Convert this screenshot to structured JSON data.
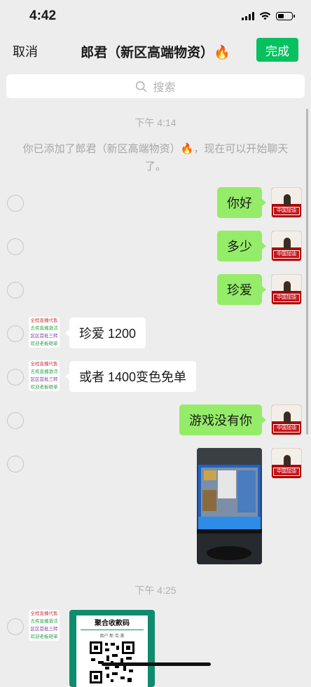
{
  "status": {
    "time": "4:42",
    "battery_level": 0.45
  },
  "nav": {
    "cancel_label": "取消",
    "title": "郎君（新区高端物资）🔥",
    "done_label": "完成"
  },
  "search": {
    "placeholder": "搜索"
  },
  "timestamps": [
    "下午 4:14",
    "下午 4:25"
  ],
  "system_message": "你已添加了郎君（新区高端物资）🔥，现在可以开始聊天了。",
  "contact_avatar_lines": [
    "全程直播代售",
    "去疾直播激活",
    "区区首批三转",
    "欢迎老板砸单"
  ],
  "self_avatar_text": "中国加油",
  "messages": [
    {
      "from": "self",
      "text": "你好"
    },
    {
      "from": "self",
      "text": "多少"
    },
    {
      "from": "self",
      "text": "珍爱"
    },
    {
      "from": "contact",
      "text": "珍爱 1200"
    },
    {
      "from": "contact",
      "text": "或者 1400变色免单"
    },
    {
      "from": "self",
      "text": "游戏没有你"
    },
    {
      "from": "self",
      "type": "image"
    },
    {
      "from": "contact",
      "type": "qr",
      "title": "聚合收款码",
      "subtitle": "商户 郎 合 美"
    }
  ]
}
